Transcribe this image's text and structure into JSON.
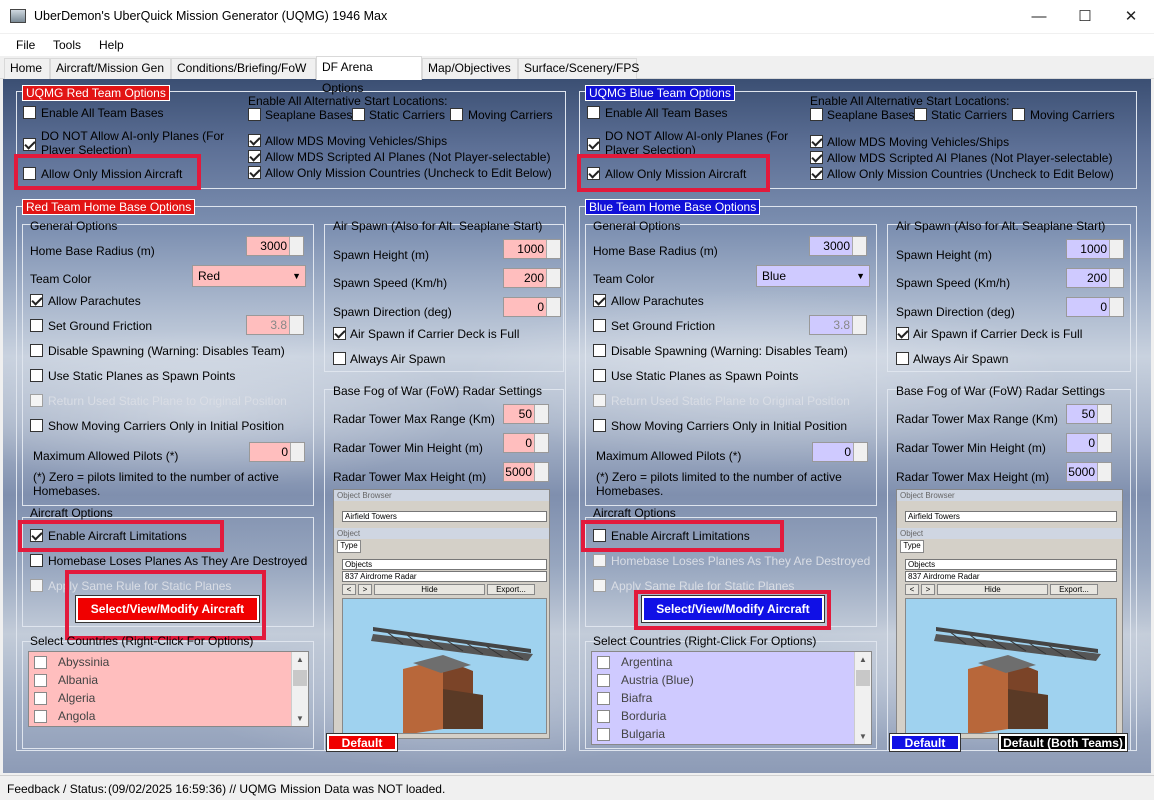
{
  "window": {
    "title": "UberDemon's UberQuick Mission Generator (UQMG) 1946 Max",
    "minimize": "—",
    "maximize": "☐",
    "close": "✕"
  },
  "menu": [
    "File",
    "Tools",
    "Help"
  ],
  "tabs": [
    "Home",
    "Aircraft/Mission Gen",
    "Conditions/Briefing/FoW",
    "DF Arena Options",
    "Map/Objectives",
    "Surface/Scenery/FPS"
  ],
  "colors": {
    "red_team": "#e21414",
    "blue_team": "#1010d8",
    "highlight": "#e21a3c",
    "red_fill": "#ffbebe",
    "blue_fill": "#cfcaff"
  },
  "red": {
    "team_header": "UQMG Red Team Options",
    "enable_all_bases": "Enable All Team Bases",
    "no_ai_only": "DO NOT Allow AI-only  Planes (For Player Selection)",
    "only_mission_aircraft": "Allow Only Mission Aircraft",
    "alt_start_header": "Enable All Alternative Start Locations:",
    "seaplane": "Seaplane Bases",
    "static_carriers": "Static Carriers",
    "moving_carriers": "Moving Carriers",
    "mds_vehicles": "Allow MDS Moving Vehicles/Ships",
    "mds_scripted": "Allow MDS Scripted AI Planes (Not Player-selectable)",
    "only_countries": "Allow Only Mission Countries (Uncheck to Edit Below)",
    "home_header": "Red Team Home Base Options",
    "general": "General Options",
    "radius_label": "Home Base Radius (m)",
    "radius": "3000",
    "color_label": "Team Color",
    "color": "Red",
    "parachutes": "Allow Parachutes",
    "ground_friction": "Set Ground Friction",
    "friction": "3.8",
    "disable_spawn": "Disable Spawning (Warning: Disables Team)",
    "static_spawn": "Use Static Planes as Spawn Points",
    "return_static": "Return Used Static Plane to Original Position",
    "moving_initial": "Show Moving Carriers Only in Initial Position",
    "max_pilots_label": "Maximum Allowed Pilots (*)",
    "max_pilots": "0",
    "note": "(*) Zero = pilots limited to the number of active Homebases.",
    "air_spawn": "Air Spawn (Also for Alt. Seaplane Start)",
    "spawn_height_label": "Spawn Height (m)",
    "spawn_height": "1000",
    "spawn_speed_label": "Spawn Speed (Km/h)",
    "spawn_speed": "200",
    "spawn_dir_label": "Spawn Direction (deg)",
    "spawn_dir": "0",
    "air_if_full": "Air Spawn if Carrier Deck is Full",
    "always_air": "Always Air Spawn",
    "fow": "Base Fog of War (FoW) Radar Settings",
    "radar_max_range_label": "Radar Tower Max Range (Km)",
    "radar_max_range": "50",
    "radar_min_h_label": "Radar Tower Min Height (m)",
    "radar_min_h": "0",
    "radar_max_h_label": "Radar Tower Max Height (m)",
    "radar_max_h": "5000",
    "aircraft_opts": "Aircraft Options",
    "enable_limits": "Enable Aircraft Limitations",
    "loses_planes": "Homebase Loses Planes As They Are Destroyed",
    "same_rule": "Apply Same Rule for Static Planes",
    "select_btn": "Select/View/Modify Aircraft",
    "countries_header": "Select Countries (Right-Click For Options)",
    "countries": [
      "Abyssinia",
      "Albania",
      "Algeria",
      "Angola"
    ],
    "default_btn": "Default"
  },
  "blue": {
    "team_header": "UQMG Blue Team Options",
    "enable_all_bases": "Enable All Team Bases",
    "no_ai_only": "DO NOT Allow AI-only  Planes (For Player Selection)",
    "only_mission_aircraft": "Allow Only Mission Aircraft",
    "alt_start_header": "Enable All Alternative Start Locations:",
    "seaplane": "Seaplane Bases",
    "static_carriers": "Static Carriers",
    "moving_carriers": "Moving Carriers",
    "mds_vehicles": "Allow MDS Moving Vehicles/Ships",
    "mds_scripted": "Allow MDS Scripted AI Planes (Not Player-selectable)",
    "only_countries": "Allow Only Mission Countries (Uncheck to Edit Below)",
    "home_header": "Blue Team Home Base Options",
    "general": "General Options",
    "radius_label": "Home Base Radius (m)",
    "radius": "3000",
    "color_label": "Team Color",
    "color": "Blue",
    "parachutes": "Allow Parachutes",
    "ground_friction": "Set Ground Friction",
    "friction": "3.8",
    "disable_spawn": "Disable Spawning (Warning: Disables Team)",
    "static_spawn": "Use Static Planes as Spawn Points",
    "return_static": "Return Used Static Plane to Original Position",
    "moving_initial": "Show Moving Carriers Only in Initial Position",
    "max_pilots_label": "Maximum Allowed Pilots (*)",
    "max_pilots": "0",
    "note": "(*) Zero = pilots limited to the number of active Homebases.",
    "air_spawn": "Air Spawn (Also for Alt. Seaplane Start)",
    "spawn_height_label": "Spawn Height (m)",
    "spawn_height": "1000",
    "spawn_speed_label": "Spawn Speed (Km/h)",
    "spawn_speed": "200",
    "spawn_dir_label": "Spawn Direction (deg)",
    "spawn_dir": "0",
    "air_if_full": "Air Spawn if Carrier Deck is Full",
    "always_air": "Always Air Spawn",
    "fow": "Base Fog of War (FoW) Radar Settings",
    "radar_max_range_label": "Radar Tower Max Range (Km)",
    "radar_max_range": "50",
    "radar_min_h_label": "Radar Tower Min Height (m)",
    "radar_min_h": "0",
    "radar_max_h_label": "Radar Tower Max Height (m)",
    "radar_max_h": "5000",
    "aircraft_opts": "Aircraft Options",
    "enable_limits": "Enable Aircraft Limitations",
    "loses_planes": "Homebase Loses Planes As They Are Destroyed",
    "same_rule": "Apply Same Rule for Static Planes",
    "select_btn": "Select/View/Modify Aircraft",
    "countries_header": "Select Countries (Right-Click For Options)",
    "countries": [
      "Argentina",
      "Austria (Blue)",
      "Biafra",
      "Borduria",
      "Bulgaria"
    ],
    "default_btn": "Default",
    "default_both_btn": "Default (Both Teams)"
  },
  "object_browser": {
    "title": "Object Browser",
    "field1": "Airfield Towers",
    "object": "Object",
    "type_tab": "Type",
    "objects": "Objects",
    "item": "837 Airdrome Radar",
    "prev": "<",
    "next": ">",
    "hide": "Hide",
    "export": "Export..."
  },
  "status": {
    "label": "Feedback / Status:",
    "text": "(09/02/2025 16:59:36) // UQMG Mission Data was NOT loaded."
  }
}
